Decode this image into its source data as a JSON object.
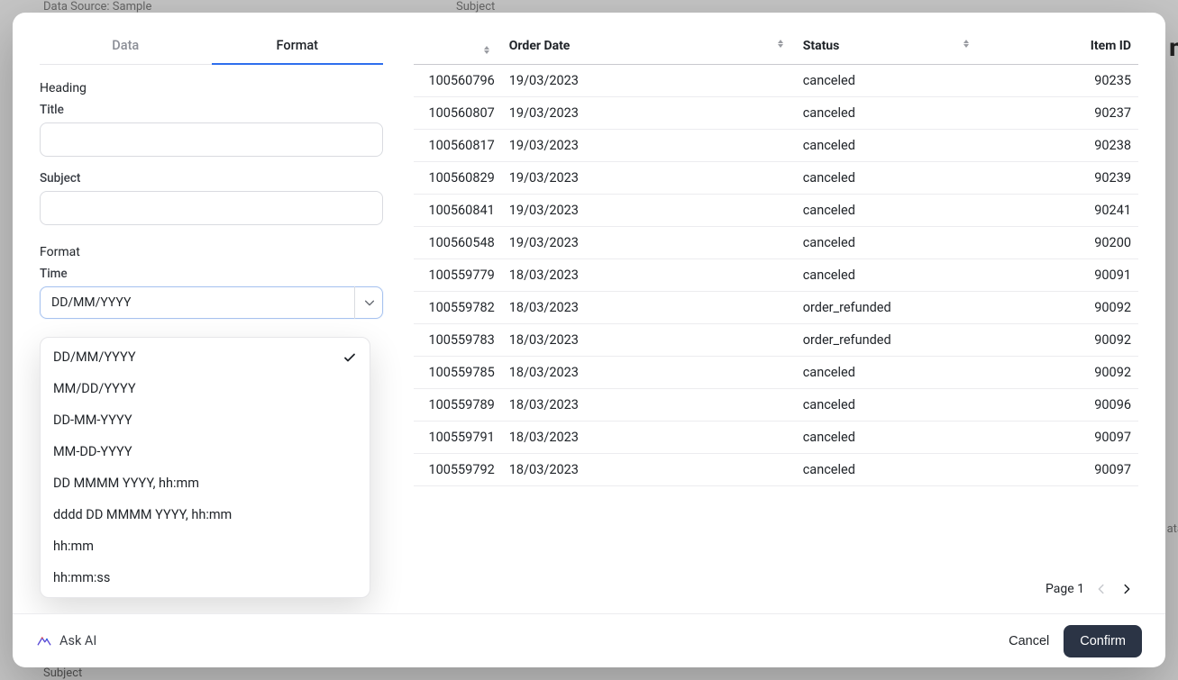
{
  "background": {
    "dataSource": "Data Source: Sample",
    "subject_bg": "Subject",
    "right_letter": "n",
    "bottom_subject": "Subject",
    "side_data": "ata"
  },
  "tabs": {
    "data": "Data",
    "format": "Format"
  },
  "heading": {
    "section": "Heading",
    "title_label": "Title",
    "subject_label": "Subject",
    "title_value": "",
    "subject_value": ""
  },
  "format": {
    "section": "Format",
    "time_label": "Time",
    "selected": "DD/MM/YYYY",
    "options": [
      "DD/MM/YYYY",
      "MM/DD/YYYY",
      "DD-MM-YYYY",
      "MM-DD-YYYY",
      "DD MMMM YYYY, hh:mm",
      "dddd DD MMMM YYYY, hh:mm",
      "hh:mm",
      "hh:mm:ss"
    ]
  },
  "table": {
    "columns": [
      "",
      "Order Date",
      "Status",
      "Item ID"
    ],
    "rows": [
      {
        "id": "100560796",
        "date": "19/03/2023",
        "status": "canceled",
        "item": "90235"
      },
      {
        "id": "100560807",
        "date": "19/03/2023",
        "status": "canceled",
        "item": "90237"
      },
      {
        "id": "100560817",
        "date": "19/03/2023",
        "status": "canceled",
        "item": "90238"
      },
      {
        "id": "100560829",
        "date": "19/03/2023",
        "status": "canceled",
        "item": "90239"
      },
      {
        "id": "100560841",
        "date": "19/03/2023",
        "status": "canceled",
        "item": "90241"
      },
      {
        "id": "100560548",
        "date": "19/03/2023",
        "status": "canceled",
        "item": "90200"
      },
      {
        "id": "100559779",
        "date": "18/03/2023",
        "status": "canceled",
        "item": "90091"
      },
      {
        "id": "100559782",
        "date": "18/03/2023",
        "status": "order_refunded",
        "item": "90092"
      },
      {
        "id": "100559783",
        "date": "18/03/2023",
        "status": "order_refunded",
        "item": "90092"
      },
      {
        "id": "100559785",
        "date": "18/03/2023",
        "status": "canceled",
        "item": "90092"
      },
      {
        "id": "100559789",
        "date": "18/03/2023",
        "status": "canceled",
        "item": "90096"
      },
      {
        "id": "100559791",
        "date": "18/03/2023",
        "status": "canceled",
        "item": "90097"
      },
      {
        "id": "100559792",
        "date": "18/03/2023",
        "status": "canceled",
        "item": "90097"
      }
    ]
  },
  "pager": {
    "label": "Page 1"
  },
  "footer": {
    "ask_ai": "Ask AI",
    "cancel": "Cancel",
    "confirm": "Confirm"
  }
}
